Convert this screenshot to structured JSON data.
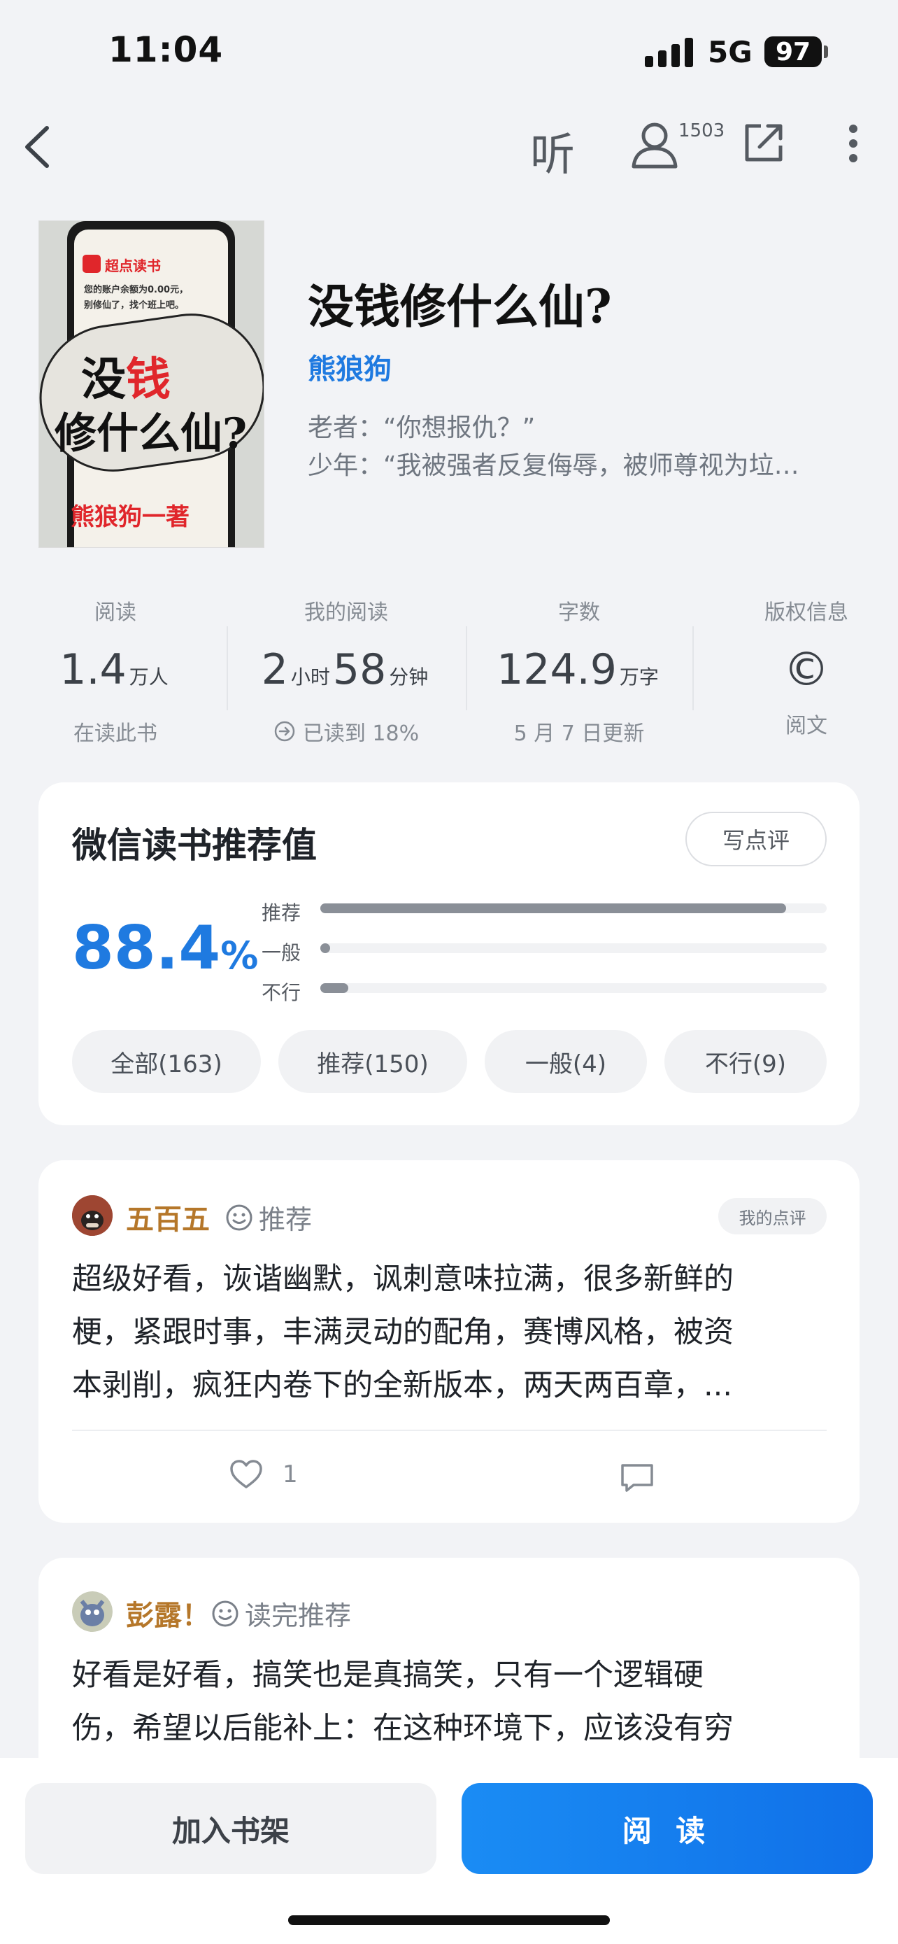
{
  "status_bar": {
    "time": "11:04",
    "network": "5G",
    "battery": "97"
  },
  "nav": {
    "listen_label": "听",
    "follow_count": "1503"
  },
  "book": {
    "title": "没钱修什么仙?",
    "author": "熊狼狗",
    "blurb_line1": "老者：“你想报仇？”",
    "blurb_line2": "少年：“我被强者反复侮辱，被师尊视为垃…",
    "cover": {
      "app_name": "超点读书",
      "message_line1": "您的账户余额为0.00元，",
      "message_line2": "别修仙了，找个班上吧。",
      "title_part1": "没",
      "title_part2": "钱",
      "title_line2": "修什么仙?",
      "byline": "熊狼狗一著"
    }
  },
  "stats": [
    {
      "label": "阅读",
      "value": "1.4",
      "unit": "万人",
      "sub": "在读此书"
    },
    {
      "label": "我的阅读",
      "hours": "2",
      "hours_unit": "小时",
      "minutes": "58",
      "minutes_unit": "分钟",
      "sub": "已读到 18%"
    },
    {
      "label": "字数",
      "value": "124.9",
      "unit": "万字",
      "sub": "5 月 7 日更新"
    },
    {
      "label": "版权信息",
      "symbol": "©",
      "sub": "阅文"
    }
  ],
  "recommend": {
    "title": "微信读书推荐值",
    "write_review": "写点评",
    "score": "88.4",
    "score_unit": "%",
    "bars": [
      {
        "label": "推荐",
        "fraction": 0.92
      },
      {
        "label": "一般",
        "fraction": 0.02
      },
      {
        "label": "不行",
        "fraction": 0.055
      }
    ],
    "filters": [
      "全部(163)",
      "推荐(150)",
      "一般(4)",
      "不行(9)"
    ]
  },
  "reviews": [
    {
      "name": "五百五",
      "tag": "推荐",
      "badge": "我的点评",
      "lines": [
        "超级好看，诙谐幽默，讽刺意味拉满，很多新鲜的",
        "梗，紧跟时事，丰满灵动的配角，赛博风格，被资",
        "本剥削，疯狂内卷下的全新版本，两天两百章，..."
      ],
      "likes": "1"
    },
    {
      "name": "彭露！",
      "tag": "读完推荐",
      "lines": [
        "好看是好看，搞笑也是真搞笑，只有一个逻辑硬",
        "伤，希望以后能补上：在这种环境下，应该没有穷"
      ]
    }
  ],
  "bottom": {
    "add_shelf": "加入书架",
    "read": "阅 读"
  },
  "colors": {
    "accent": "#1f7ae0",
    "review_name": "#b5772a",
    "cover_red": "#e0262b"
  }
}
